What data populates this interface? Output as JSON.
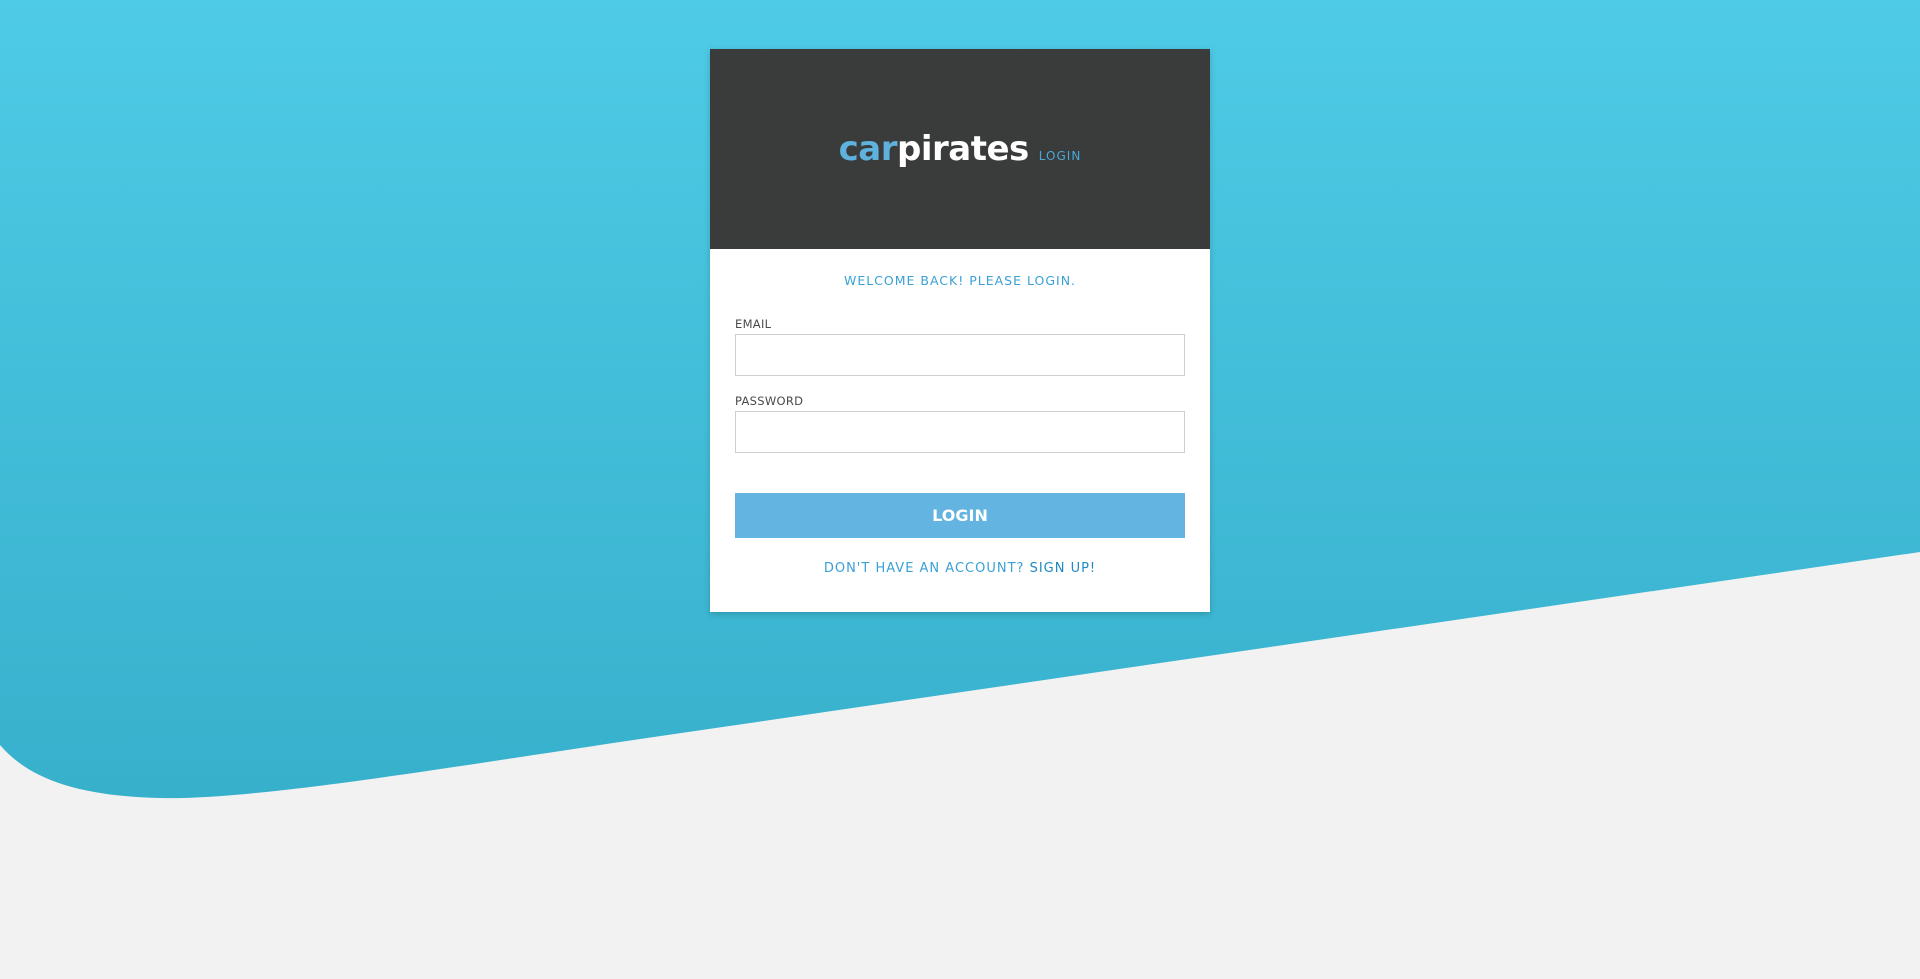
{
  "logo": {
    "car": "car",
    "pirates": "pirates",
    "tag": "LOGIN"
  },
  "welcome_text": "WELCOME BACK! PLEASE LOGIN.",
  "form": {
    "email_label": "EMAIL",
    "email_value": "",
    "password_label": "PASSWORD",
    "password_value": "",
    "login_button": "LOGIN"
  },
  "signup": {
    "prompt": "DON'T HAVE AN ACCOUNT?",
    "link": "SIGN UP!"
  },
  "colors": {
    "background_top": "#4ecbe6",
    "background_bottom": "#37b0cc",
    "page_background": "#f2f2f2",
    "header": "#3a3b3b",
    "accent": "#63b4e0",
    "text_accent": "#3aa0d6"
  }
}
